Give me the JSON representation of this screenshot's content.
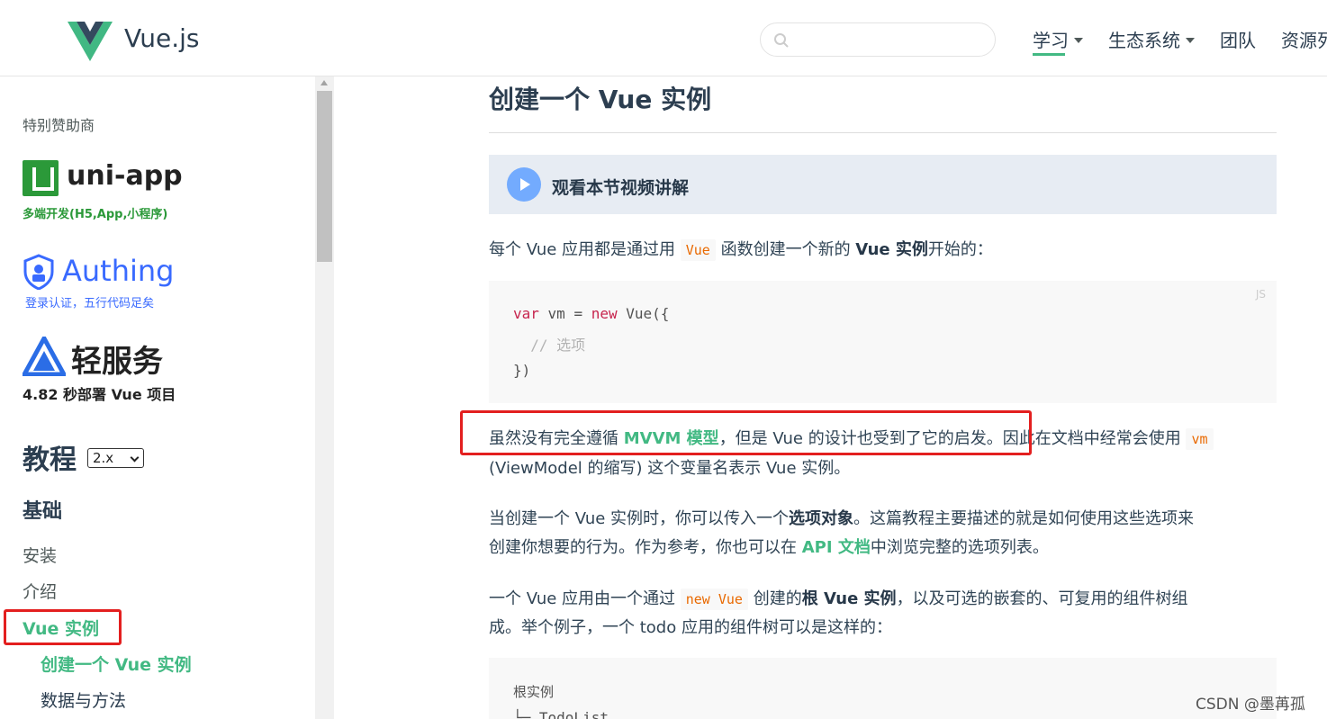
{
  "header": {
    "logo_text": "Vue.js",
    "search_placeholder": "",
    "nav": [
      {
        "label": "学习",
        "has_dropdown": true,
        "active": true
      },
      {
        "label": "生态系统",
        "has_dropdown": true,
        "active": false
      },
      {
        "label": "团队",
        "has_dropdown": false,
        "active": false
      },
      {
        "label": "资源列",
        "has_dropdown": false,
        "active": false
      }
    ]
  },
  "sidebar": {
    "sponsor_label": "特别赞助商",
    "sponsors": [
      {
        "name": "uni-app",
        "tagline": "多端开发(H5,App,小程序)"
      },
      {
        "name": "Authing",
        "tagline": "登录认证，五行代码足矣"
      },
      {
        "name": "轻服务",
        "tagline": "4.82 秒部署 Vue 项目"
      }
    ],
    "tutorial_title": "教程",
    "version": "2.x",
    "section": "基础",
    "links": [
      "安装",
      "介绍",
      "Vue 实例"
    ],
    "sublinks": [
      "创建一个 Vue 实例",
      "数据与方法"
    ]
  },
  "main": {
    "heading": "创建一个 Vue 实例",
    "video_label": "观看本节视频讲解",
    "p1": {
      "pre": "每个 Vue 应用都是通过用 ",
      "code": "Vue",
      "mid": " 函数创建一个新的 ",
      "bold": "Vue 实例",
      "post": "开始的："
    },
    "code1": {
      "lang": "JS",
      "lines": {
        "l1_kw1": "var",
        "l1_a": " vm = ",
        "l1_kw2": "new",
        "l1_b": " Vue({",
        "l2": "  // 选项",
        "l3": "})"
      }
    },
    "p2": {
      "pre": "虽然没有完全遵循 ",
      "link": "MVVM 模型",
      "mid": "，但是 Vue 的设计也受到了它的启发。因此在文档中经常会使用 ",
      "code": "vm",
      "line2": "(ViewModel 的缩写) 这个变量名表示 Vue 实例。"
    },
    "p3": {
      "pre": "当创建一个 Vue 实例时，你可以传入一个",
      "bold": "选项对象",
      "post": "。这篇教程主要描述的就是如何使用这些选项来",
      "line2_pre": "创建你想要的行为。作为参考，你也可以在 ",
      "link": "API 文档",
      "line2_post": "中浏览完整的选项列表。"
    },
    "p4": {
      "pre": "一个 Vue 应用由一个通过 ",
      "code": "new Vue",
      "mid": " 创建的",
      "bold": "根 Vue 实例",
      "post": "，以及可选的嵌套的、可复用的组件树组",
      "line2": "成。举个例子，一个 todo 应用的组件树可以是这样的："
    },
    "code2": {
      "l1": "根实例",
      "l2": "└─ TodoList"
    }
  },
  "watermark": "CSDN @墨苒孤",
  "colors": {
    "accent": "#42b983",
    "text": "#2c3e50",
    "highlight": "#e31f1f",
    "code": "#e96900"
  }
}
